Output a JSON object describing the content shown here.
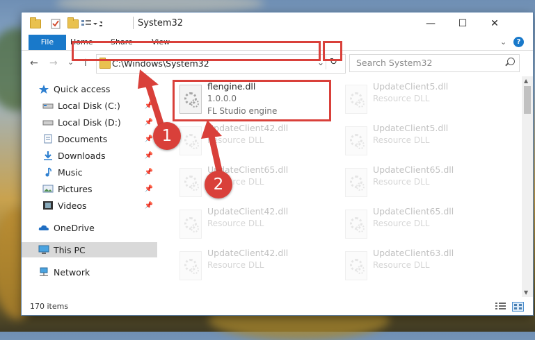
{
  "window": {
    "title": "System32",
    "minimize_glyph": "—",
    "maximize_glyph": "☐",
    "close_glyph": "✕"
  },
  "ribbon": {
    "tabs": [
      "File",
      "Home",
      "Share",
      "View"
    ],
    "expand_glyph": "⌄",
    "help_glyph": "?"
  },
  "nav": {
    "back_glyph": "←",
    "forward_glyph": "→",
    "recent_glyph": "⌄",
    "up_glyph": "↑"
  },
  "address": {
    "path": "C:\\Windows\\System32",
    "dropdown_glyph": "⌄",
    "refresh_glyph": "↻"
  },
  "search": {
    "placeholder": "Search System32"
  },
  "sidebar": {
    "items": [
      {
        "label": "Quick access",
        "icon": "star-icon"
      },
      {
        "label": "Local Disk (C:)",
        "icon": "drive-icon"
      },
      {
        "label": "Local Disk (D:)",
        "icon": "drive-icon"
      },
      {
        "label": "Documents",
        "icon": "documents-icon"
      },
      {
        "label": "Downloads",
        "icon": "download-icon"
      },
      {
        "label": "Music",
        "icon": "music-icon"
      },
      {
        "label": "Pictures",
        "icon": "pictures-icon"
      },
      {
        "label": "Videos",
        "icon": "videos-icon"
      },
      {
        "label": "OneDrive",
        "icon": "cloud-icon"
      },
      {
        "label": "This PC",
        "icon": "computer-icon"
      },
      {
        "label": "Network",
        "icon": "network-icon"
      }
    ]
  },
  "files": [
    {
      "name": "flengine.dll",
      "line1": "1.0.0.0",
      "line2": "FL Studio engine"
    },
    {
      "name": "UpdateClient5.dll",
      "line1": "Resource DLL"
    },
    {
      "name": "UpdateClient42.dll",
      "line1": "Resource DLL"
    },
    {
      "name": "UpdateClient5.dll",
      "line1": "Resource DLL"
    },
    {
      "name": "UpdateClient65.dll",
      "line1": "Resource DLL"
    },
    {
      "name": "UpdateClient65.dll",
      "line1": "Resource DLL"
    },
    {
      "name": "UpdateClient42.dll",
      "line1": "Resource DLL"
    },
    {
      "name": "UpdateClient65.dll",
      "line1": "Resource DLL"
    },
    {
      "name": "UpdateClient42.dll",
      "line1": "Resource DLL"
    },
    {
      "name": "UpdateClient63.dll",
      "line1": "Resource DLL"
    }
  ],
  "status": {
    "item_count": "170 items"
  },
  "annotations": {
    "badge1": "1",
    "badge2": "2",
    "color": "#d9403a"
  }
}
